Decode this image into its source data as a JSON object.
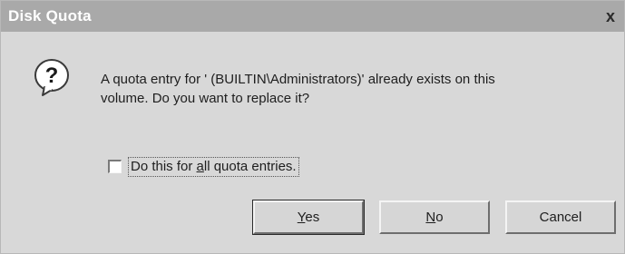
{
  "window": {
    "title": "Disk Quota",
    "close_glyph": "x"
  },
  "icon": {
    "name": "question-icon",
    "glyph": "?"
  },
  "message": {
    "line1": "A quota entry for ' (BUILTIN\\Administrators)' already exists on this",
    "line2": "volume.  Do you want to replace it?"
  },
  "checkbox": {
    "label_before": "Do this for ",
    "label_ul": "a",
    "label_after": "ll quota entries.",
    "checked": false
  },
  "buttons": {
    "yes": {
      "ul": "Y",
      "rest": "es"
    },
    "no": {
      "ul": "N",
      "rest": "o"
    },
    "cancel": {
      "label": "Cancel"
    }
  }
}
